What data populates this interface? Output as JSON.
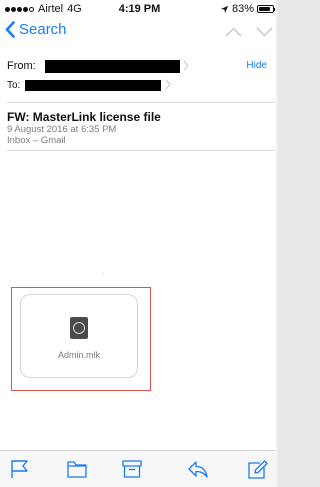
{
  "status_bar": {
    "carrier": "Airtel",
    "network": "4G",
    "time": "4:19 PM",
    "battery_pct": "83%",
    "battery_level": 0.83,
    "signal_bars_filled": 4,
    "signal_bars_total": 5
  },
  "nav": {
    "back_label": "Search",
    "accent_color": "#1a7cf5"
  },
  "header": {
    "from_label": "From:",
    "to_label": "To:",
    "hide_label": "Hide"
  },
  "message": {
    "subject": "FW: MasterLink license file",
    "date": "9 August 2016 at 6:35 PM",
    "mailbox": "Inbox – Gmail"
  },
  "attachment": {
    "file_name": "Admin.mlk",
    "icon": "masterlink-file-icon",
    "highlight_color": "#d9534f"
  },
  "toolbar": {
    "icons": [
      "flag-icon",
      "folder-icon",
      "archive-icon",
      "reply-icon",
      "compose-icon"
    ]
  }
}
